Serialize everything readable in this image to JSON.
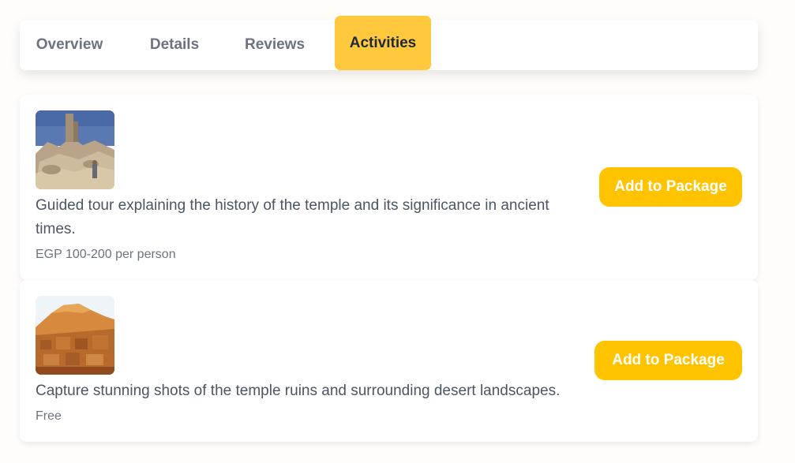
{
  "tabs": [
    {
      "label": "Overview",
      "active": false
    },
    {
      "label": "Details",
      "active": false
    },
    {
      "label": "Reviews",
      "active": false
    },
    {
      "label": "Activities",
      "active": true
    }
  ],
  "activities": [
    {
      "image": "temple-ruins-photo",
      "description": "Guided tour explaining the history of the temple and its significance in ancient times.",
      "price": "EGP 100-200 per person",
      "button_label": "Add to Package"
    },
    {
      "image": "desert-town-photo",
      "description": "Capture stunning shots of the temple ruins and surrounding desert landscapes.",
      "price": "Free",
      "button_label": "Add to Package"
    }
  ],
  "colors": {
    "accent": "#ffc83d",
    "button": "#ffc300",
    "background": "#fffdf9"
  }
}
